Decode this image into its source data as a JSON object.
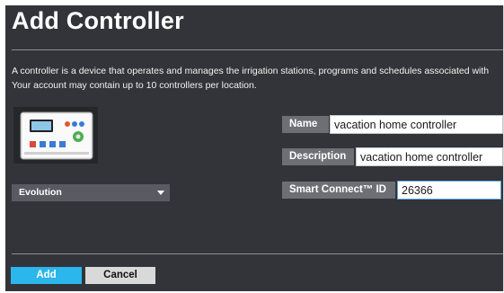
{
  "page": {
    "title": "Add Controller",
    "description_lines": [
      "A controller is a device that operates and manages the irrigation stations, programs and schedules associated with",
      "Your account may contain up to 10 controllers per location."
    ]
  },
  "controller_image": {
    "icon": "controller-device-image"
  },
  "model_select": {
    "selected": "Evolution"
  },
  "form": {
    "name_label": "Name",
    "name_value": "vacation home controller",
    "description_label": "Description",
    "description_value": "vacation home controller",
    "smart_connect_label": "Smart Connect™ ID",
    "smart_connect_value": "26366"
  },
  "actions": {
    "add_label": "Add",
    "cancel_label": "Cancel"
  },
  "colors": {
    "panel_bg": "#333439",
    "label_bg": "#6e6f75",
    "add_button": "#2bb6ec",
    "cancel_button": "#d9d9d9",
    "focus_border": "#5fa8e6"
  }
}
